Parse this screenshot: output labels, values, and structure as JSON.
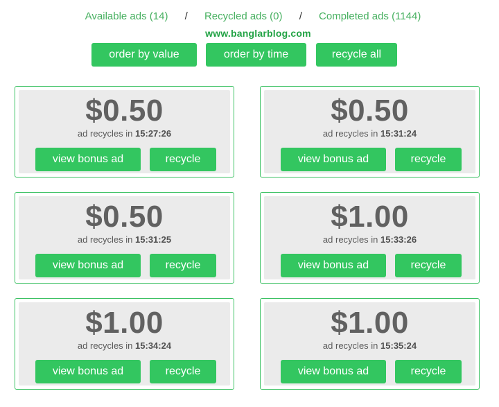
{
  "tabs": [
    {
      "label": "Available ads (14)"
    },
    {
      "label": "Recycled ads (0)"
    },
    {
      "label": "Completed ads (1144)"
    }
  ],
  "separator": "/",
  "watermark": "www.banglarblog.com",
  "toolbar": {
    "order_by_value": "order by value",
    "order_by_time": "order by time",
    "recycle_all": "recycle all"
  },
  "ads": [
    {
      "value": "$0.50",
      "recycle_prefix": "ad recycles in",
      "recycle_time": "15:27:26",
      "view_label": "view bonus ad",
      "recycle_label": "recycle"
    },
    {
      "value": "$0.50",
      "recycle_prefix": "ad recycles in",
      "recycle_time": "15:31:24",
      "view_label": "view bonus ad",
      "recycle_label": "recycle"
    },
    {
      "value": "$0.50",
      "recycle_prefix": "ad recycles in",
      "recycle_time": "15:31:25",
      "view_label": "view bonus ad",
      "recycle_label": "recycle"
    },
    {
      "value": "$1.00",
      "recycle_prefix": "ad recycles in",
      "recycle_time": "15:33:26",
      "view_label": "view bonus ad",
      "recycle_label": "recycle"
    },
    {
      "value": "$1.00",
      "recycle_prefix": "ad recycles in",
      "recycle_time": "15:34:24",
      "view_label": "view bonus ad",
      "recycle_label": "recycle"
    },
    {
      "value": "$1.00",
      "recycle_prefix": "ad recycles in",
      "recycle_time": "15:35:24",
      "view_label": "view bonus ad",
      "recycle_label": "recycle"
    }
  ],
  "colors": {
    "accent": "#33c660",
    "tab_text": "#47b060",
    "price_text": "#616161",
    "card_bg": "#ebebeb",
    "card_border": "#3cc163"
  }
}
